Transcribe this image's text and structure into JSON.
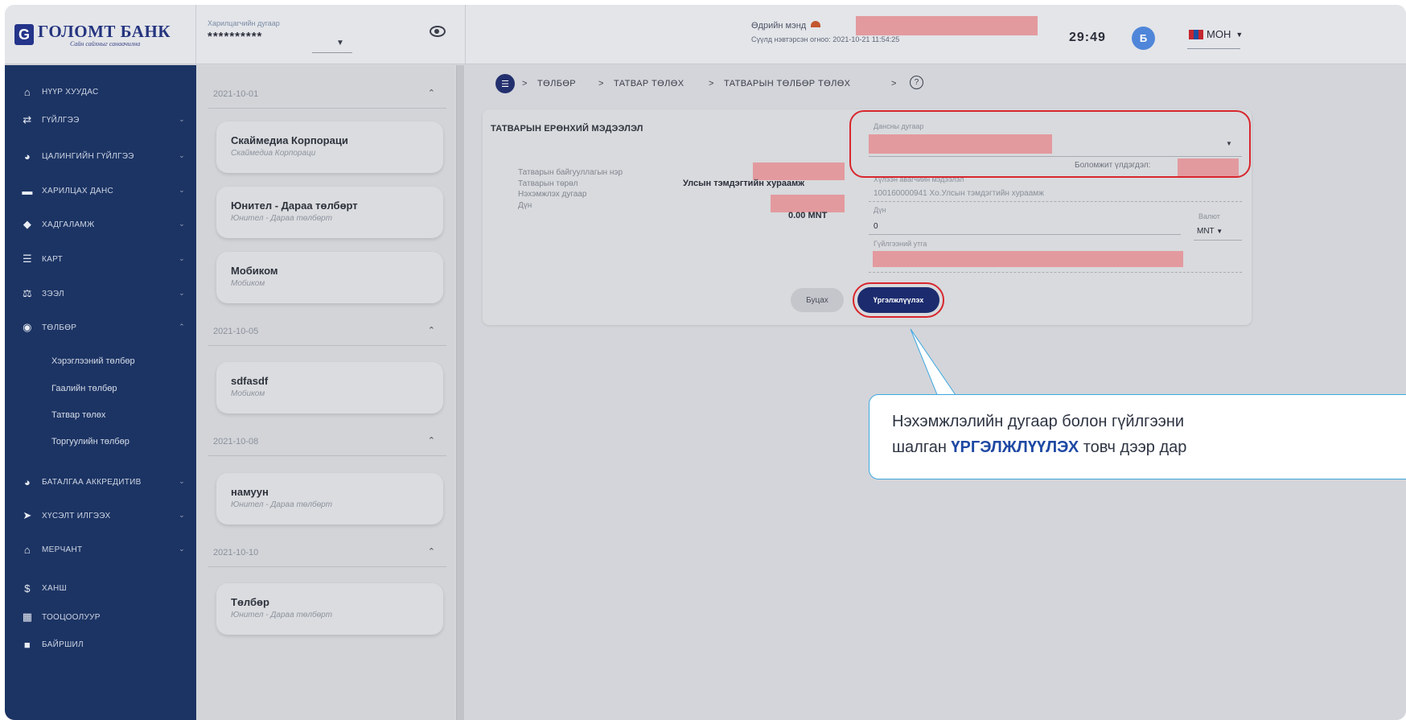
{
  "header": {
    "bank_name": "ГОЛОМТ БАНК",
    "slogan": "Сайн сайхныг санаачилна",
    "client_label": "Харилцагчийн дугаар",
    "client_value": "**********",
    "greeting": "Өдрийн мэнд",
    "last_login": "Сүүлд нэвтэрсэн огноо: 2021-10-21 11:54:25",
    "timer": "29:49",
    "avatar_letter": "Б",
    "language": "МОН"
  },
  "sidebar": {
    "items": [
      {
        "label": "НҮҮР ХУУДАС",
        "icon": "home-icon",
        "glyph": "⌂"
      },
      {
        "label": "ГҮЙЛГЭЭ",
        "icon": "transfer-icon",
        "glyph": "⇄"
      },
      {
        "label": "ЦАЛИНГИЙН ГҮЙЛГЭЭ",
        "icon": "pie-chart-icon",
        "glyph": "◕"
      },
      {
        "label": "ХАРИЛЦАХ ДАНС",
        "icon": "account-icon",
        "glyph": "▬"
      },
      {
        "label": "ХАДГАЛАМЖ",
        "icon": "piggy-bank-icon",
        "glyph": "◆"
      },
      {
        "label": "КАРТ",
        "icon": "card-icon",
        "glyph": "☰"
      },
      {
        "label": "ЗЭЭЛ",
        "icon": "loan-icon",
        "glyph": "⚖"
      },
      {
        "label": "ТӨЛБӨР",
        "icon": "payment-icon",
        "glyph": "◉"
      },
      {
        "label": "БАТАЛГАА АККРЕДИТИВ",
        "icon": "guarantee-icon",
        "glyph": "◕"
      },
      {
        "label": "ХҮСЭЛТ ИЛГЭЭХ",
        "icon": "send-icon",
        "glyph": "➤"
      },
      {
        "label": "МЕРЧАНТ",
        "icon": "shop-icon",
        "glyph": "⌂"
      },
      {
        "label": "ХАНШ",
        "icon": "dollar-icon",
        "glyph": "$"
      },
      {
        "label": "ТООЦООЛУУР",
        "icon": "calculator-icon",
        "glyph": "▦"
      },
      {
        "label": "БАЙРШИЛ",
        "icon": "atm-icon",
        "glyph": "■"
      }
    ],
    "subitems": [
      "Хэрэглээний төлбөр",
      "Гаалийн төлбөр",
      "Татвар төлөх",
      "Торгуулийн төлбөр"
    ]
  },
  "history": {
    "groups": [
      {
        "date": "2021-10-01",
        "cards": [
          {
            "title": "Скаймедиа Корпораци",
            "subtitle": "Скаймедиа Корпораци"
          },
          {
            "title": "Юнител - Дараа төлбөрт",
            "subtitle": "Юнител - Дараа төлбөрт"
          },
          {
            "title": "Мобиком",
            "subtitle": "Мобиком"
          }
        ]
      },
      {
        "date": "2021-10-05",
        "cards": [
          {
            "title": "sdfasdf",
            "subtitle": "Мобиком"
          }
        ]
      },
      {
        "date": "2021-10-08",
        "cards": [
          {
            "title": "намуун",
            "subtitle": "Юнител - Дараа төлбөрт"
          }
        ]
      },
      {
        "date": "2021-10-10",
        "cards": [
          {
            "title": "Төлбөр",
            "subtitle": "Юнител - Дараа төлбөрт"
          }
        ]
      }
    ]
  },
  "breadcrumb": [
    "ТӨЛБӨР",
    "ТАТВАР ТӨЛӨХ",
    "ТАТВАРЫН ТӨЛБӨР ТӨЛӨХ"
  ],
  "tax_info": {
    "title": "ТАТВАРЫН ЕРӨНХИЙ МЭДЭЭЛЭЛ",
    "org_name_label": "Татварын байгууллагын нэр",
    "type_label": "Татварын төрөл",
    "type_value": "Улсын тэмдэгтийн хураамж",
    "claim_no_label": "Нэхэмжлэх дугаар",
    "amount_label": "Дүн",
    "amount_value": "0.00 MNT"
  },
  "form": {
    "account_label": "Дансны дугаар",
    "available_balance_label": "Боломжит үлдэгдэл:",
    "receiver_label": "Хүлээн авагчийн мэдээлэл",
    "receiver_value": "100160000941 Хо.Улсын тэмдэгтийн хураамж",
    "amount_label": "Дүн",
    "amount_value": "0",
    "currency_label": "Валют",
    "currency_value": "MNT",
    "description_label": "Гүйлгээний утга",
    "back_label": "Буцах",
    "continue_label": "Үргэлжлүүлэх"
  },
  "callout": {
    "line1": "Нэхэмжлэлийн дугаар болон гүйлгээни",
    "line2_prefix": "шалган ",
    "line2_bold": "ҮРГЭЛЖЛҮҮЛЭХ",
    "line2_suffix": " товч дээр дар"
  },
  "colors": {
    "brand": "#1c3464",
    "primary_button": "#1b2b6e",
    "highlight": "#d8262d",
    "callout_border": "#3ea7e0",
    "redaction": "#e39a9e"
  }
}
